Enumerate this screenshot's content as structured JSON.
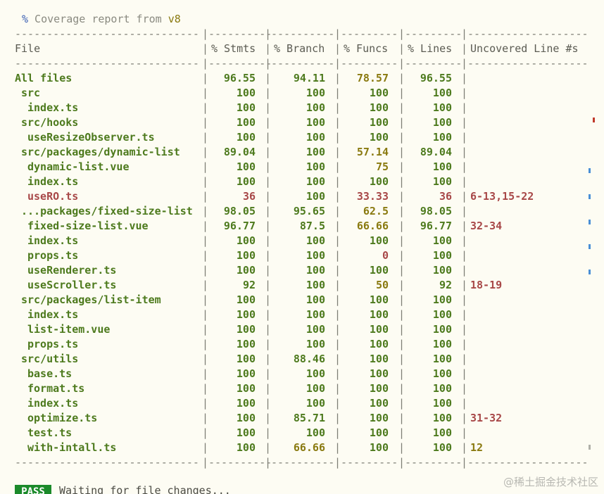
{
  "header": {
    "pct_char": "%",
    "text": " Coverage report from ",
    "engine": "v8"
  },
  "separator": {
    "file": "-----------------------------",
    "stmts": "----------",
    "branch": "----------",
    "funcs": "---------",
    "lines": "---------",
    "uncovered": "-------------------"
  },
  "columns": {
    "file": "File",
    "stmts": "% Stmts",
    "branch": "% Branch",
    "funcs": "% Funcs",
    "lines": "% Lines",
    "uncovered": "Uncovered Line #s"
  },
  "rows": [
    {
      "file": "All files",
      "indent": 0,
      "stmts": "96.55",
      "branch": "94.11",
      "funcs": "78.57",
      "lines": "96.55",
      "uncovered": "",
      "colors": [
        "green",
        "green",
        "green",
        "yellow",
        "green"
      ]
    },
    {
      "file": "src",
      "indent": 1,
      "stmts": "100",
      "branch": "100",
      "funcs": "100",
      "lines": "100",
      "uncovered": "",
      "colors": [
        "green",
        "green",
        "green",
        "green",
        "green"
      ]
    },
    {
      "file": "index.ts",
      "indent": 2,
      "stmts": "100",
      "branch": "100",
      "funcs": "100",
      "lines": "100",
      "uncovered": "",
      "colors": [
        "green",
        "green",
        "green",
        "green",
        "green"
      ]
    },
    {
      "file": "src/hooks",
      "indent": 1,
      "stmts": "100",
      "branch": "100",
      "funcs": "100",
      "lines": "100",
      "uncovered": "",
      "colors": [
        "green",
        "green",
        "green",
        "green",
        "green"
      ]
    },
    {
      "file": "useResizeObserver.ts",
      "indent": 2,
      "stmts": "100",
      "branch": "100",
      "funcs": "100",
      "lines": "100",
      "uncovered": "",
      "colors": [
        "green",
        "green",
        "green",
        "green",
        "green"
      ]
    },
    {
      "file": "src/packages/dynamic-list",
      "indent": 1,
      "stmts": "89.04",
      "branch": "100",
      "funcs": "57.14",
      "lines": "89.04",
      "uncovered": "",
      "colors": [
        "green",
        "green",
        "green",
        "yellow",
        "green"
      ]
    },
    {
      "file": "dynamic-list.vue",
      "indent": 2,
      "stmts": "100",
      "branch": "100",
      "funcs": "75",
      "lines": "100",
      "uncovered": "",
      "colors": [
        "green",
        "green",
        "green",
        "yellow",
        "green"
      ]
    },
    {
      "file": "index.ts",
      "indent": 2,
      "stmts": "100",
      "branch": "100",
      "funcs": "100",
      "lines": "100",
      "uncovered": "",
      "colors": [
        "green",
        "green",
        "green",
        "green",
        "green"
      ]
    },
    {
      "file": "useRO.ts",
      "indent": 2,
      "stmts": "36",
      "branch": "100",
      "funcs": "33.33",
      "lines": "36",
      "uncovered": "6-13,15-22",
      "colors": [
        "red",
        "red",
        "green",
        "red",
        "red"
      ]
    },
    {
      "file": "...packages/fixed-size-list",
      "indent": 1,
      "stmts": "98.05",
      "branch": "95.65",
      "funcs": "62.5",
      "lines": "98.05",
      "uncovered": "",
      "colors": [
        "green",
        "green",
        "green",
        "yellow",
        "green"
      ]
    },
    {
      "file": "fixed-size-list.vue",
      "indent": 2,
      "stmts": "96.77",
      "branch": "87.5",
      "funcs": "66.66",
      "lines": "96.77",
      "uncovered": "32-34",
      "colors": [
        "green",
        "green",
        "green",
        "yellow",
        "green"
      ]
    },
    {
      "file": "index.ts",
      "indent": 2,
      "stmts": "100",
      "branch": "100",
      "funcs": "100",
      "lines": "100",
      "uncovered": "",
      "colors": [
        "green",
        "green",
        "green",
        "green",
        "green"
      ]
    },
    {
      "file": "props.ts",
      "indent": 2,
      "stmts": "100",
      "branch": "100",
      "funcs": "0",
      "lines": "100",
      "uncovered": "",
      "colors": [
        "green",
        "green",
        "green",
        "red",
        "green"
      ]
    },
    {
      "file": "useRenderer.ts",
      "indent": 2,
      "stmts": "100",
      "branch": "100",
      "funcs": "100",
      "lines": "100",
      "uncovered": "",
      "colors": [
        "green",
        "green",
        "green",
        "green",
        "green"
      ]
    },
    {
      "file": "useScroller.ts",
      "indent": 2,
      "stmts": "92",
      "branch": "100",
      "funcs": "50",
      "lines": "92",
      "uncovered": "18-19",
      "colors": [
        "green",
        "green",
        "green",
        "yellow",
        "green"
      ]
    },
    {
      "file": "src/packages/list-item",
      "indent": 1,
      "stmts": "100",
      "branch": "100",
      "funcs": "100",
      "lines": "100",
      "uncovered": "",
      "colors": [
        "green",
        "green",
        "green",
        "green",
        "green"
      ]
    },
    {
      "file": "index.ts",
      "indent": 2,
      "stmts": "100",
      "branch": "100",
      "funcs": "100",
      "lines": "100",
      "uncovered": "",
      "colors": [
        "green",
        "green",
        "green",
        "green",
        "green"
      ]
    },
    {
      "file": "list-item.vue",
      "indent": 2,
      "stmts": "100",
      "branch": "100",
      "funcs": "100",
      "lines": "100",
      "uncovered": "",
      "colors": [
        "green",
        "green",
        "green",
        "green",
        "green"
      ]
    },
    {
      "file": "props.ts",
      "indent": 2,
      "stmts": "100",
      "branch": "100",
      "funcs": "100",
      "lines": "100",
      "uncovered": "",
      "colors": [
        "green",
        "green",
        "green",
        "green",
        "green"
      ]
    },
    {
      "file": "src/utils",
      "indent": 1,
      "stmts": "100",
      "branch": "88.46",
      "funcs": "100",
      "lines": "100",
      "uncovered": "",
      "colors": [
        "green",
        "green",
        "green",
        "green",
        "green"
      ]
    },
    {
      "file": "base.ts",
      "indent": 2,
      "stmts": "100",
      "branch": "100",
      "funcs": "100",
      "lines": "100",
      "uncovered": "",
      "colors": [
        "green",
        "green",
        "green",
        "green",
        "green"
      ]
    },
    {
      "file": "format.ts",
      "indent": 2,
      "stmts": "100",
      "branch": "100",
      "funcs": "100",
      "lines": "100",
      "uncovered": "",
      "colors": [
        "green",
        "green",
        "green",
        "green",
        "green"
      ]
    },
    {
      "file": "index.ts",
      "indent": 2,
      "stmts": "100",
      "branch": "100",
      "funcs": "100",
      "lines": "100",
      "uncovered": "",
      "colors": [
        "green",
        "green",
        "green",
        "green",
        "green"
      ]
    },
    {
      "file": "optimize.ts",
      "indent": 2,
      "stmts": "100",
      "branch": "85.71",
      "funcs": "100",
      "lines": "100",
      "uncovered": "31-32",
      "colors": [
        "green",
        "green",
        "green",
        "green",
        "green"
      ]
    },
    {
      "file": "test.ts",
      "indent": 2,
      "stmts": "100",
      "branch": "100",
      "funcs": "100",
      "lines": "100",
      "uncovered": "",
      "colors": [
        "green",
        "green",
        "green",
        "green",
        "green"
      ]
    },
    {
      "file": "with-intall.ts",
      "indent": 2,
      "stmts": "100",
      "branch": "66.66",
      "funcs": "100",
      "lines": "100",
      "uncovered": "12",
      "colors": [
        "green",
        "green",
        "yellow",
        "green",
        "green"
      ]
    }
  ],
  "status": {
    "badge": "PASS",
    "text": "Waiting for file changes..."
  },
  "watermark": "@稀土掘金技术社区",
  "theme": {
    "background": "#fdfcf3",
    "green": "#4d7a1d",
    "yellow": "#8a7a10",
    "red": "#a84848",
    "pass_badge": "#1b8a2a"
  }
}
